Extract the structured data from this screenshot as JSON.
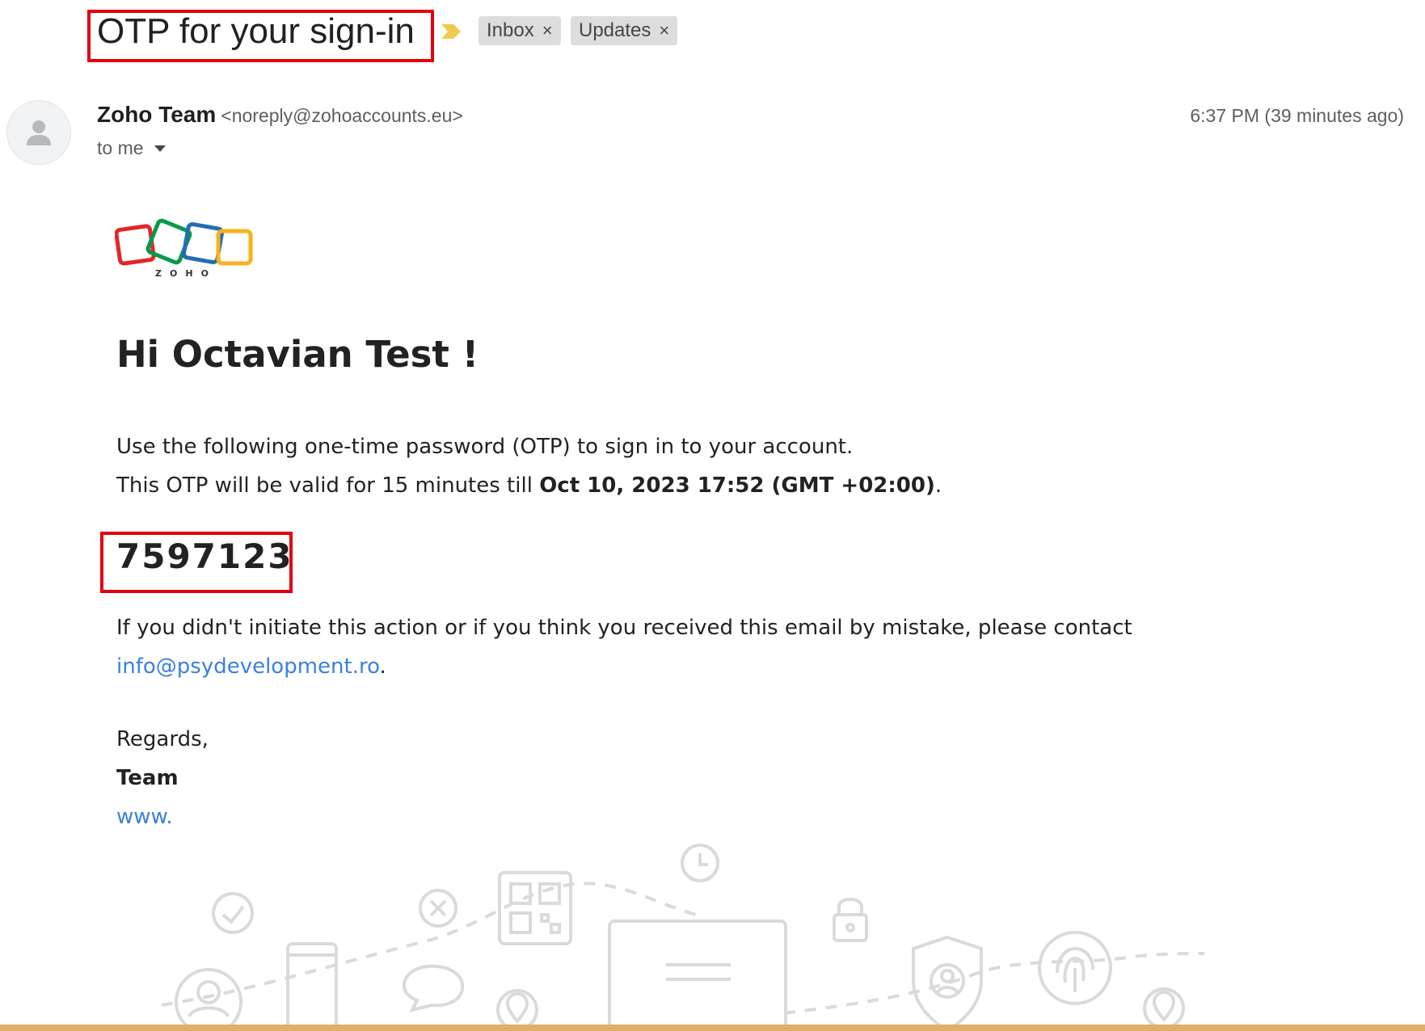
{
  "email": {
    "subject": "OTP for your sign-in",
    "labels": [
      {
        "text": "Inbox",
        "remove": "×"
      },
      {
        "text": "Updates",
        "remove": "×"
      }
    ],
    "sender_name": "Zoho Team",
    "sender_email": "<noreply@zohoaccounts.eu>",
    "recipient": "to me",
    "timestamp": "6:37 PM (39 minutes ago)"
  },
  "body": {
    "logo_text": "ZOHO",
    "greeting": "Hi Octavian Test !",
    "line1": "Use the following one-time password (OTP) to sign in to your account.",
    "line2_prefix": "This OTP will be valid for 15 minutes till ",
    "line2_bold": "Oct 10, 2023 17:52 (GMT +02:00)",
    "line2_suffix": ".",
    "otp": "7597123",
    "contact_text": "If you didn't initiate this action or if you think you received this email by mistake, please contact",
    "contact_email": "info@psydevelopment.ro",
    "contact_suffix": ".",
    "regards": "Regards,",
    "team": "Team",
    "website": "www."
  },
  "colors": {
    "annotation_box": "#e3000f",
    "link": "#3b80e0",
    "importance_marker": "#f2c94c",
    "bottom_bar": "#e0b067"
  }
}
